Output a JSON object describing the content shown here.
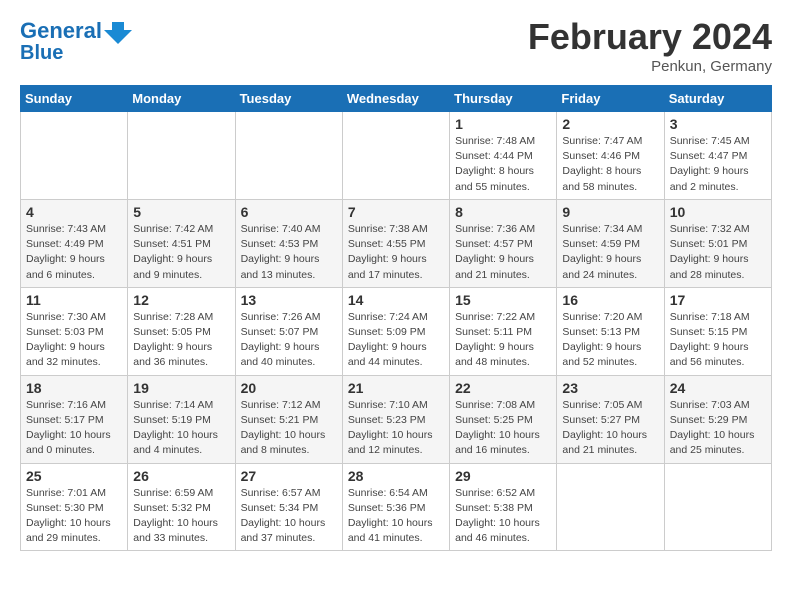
{
  "header": {
    "logo_line1": "General",
    "logo_line2": "Blue",
    "month": "February 2024",
    "location": "Penkun, Germany"
  },
  "weekdays": [
    "Sunday",
    "Monday",
    "Tuesday",
    "Wednesday",
    "Thursday",
    "Friday",
    "Saturday"
  ],
  "weeks": [
    [
      {
        "day": "",
        "info": ""
      },
      {
        "day": "",
        "info": ""
      },
      {
        "day": "",
        "info": ""
      },
      {
        "day": "",
        "info": ""
      },
      {
        "day": "1",
        "info": "Sunrise: 7:48 AM\nSunset: 4:44 PM\nDaylight: 8 hours\nand 55 minutes."
      },
      {
        "day": "2",
        "info": "Sunrise: 7:47 AM\nSunset: 4:46 PM\nDaylight: 8 hours\nand 58 minutes."
      },
      {
        "day": "3",
        "info": "Sunrise: 7:45 AM\nSunset: 4:47 PM\nDaylight: 9 hours\nand 2 minutes."
      }
    ],
    [
      {
        "day": "4",
        "info": "Sunrise: 7:43 AM\nSunset: 4:49 PM\nDaylight: 9 hours\nand 6 minutes."
      },
      {
        "day": "5",
        "info": "Sunrise: 7:42 AM\nSunset: 4:51 PM\nDaylight: 9 hours\nand 9 minutes."
      },
      {
        "day": "6",
        "info": "Sunrise: 7:40 AM\nSunset: 4:53 PM\nDaylight: 9 hours\nand 13 minutes."
      },
      {
        "day": "7",
        "info": "Sunrise: 7:38 AM\nSunset: 4:55 PM\nDaylight: 9 hours\nand 17 minutes."
      },
      {
        "day": "8",
        "info": "Sunrise: 7:36 AM\nSunset: 4:57 PM\nDaylight: 9 hours\nand 21 minutes."
      },
      {
        "day": "9",
        "info": "Sunrise: 7:34 AM\nSunset: 4:59 PM\nDaylight: 9 hours\nand 24 minutes."
      },
      {
        "day": "10",
        "info": "Sunrise: 7:32 AM\nSunset: 5:01 PM\nDaylight: 9 hours\nand 28 minutes."
      }
    ],
    [
      {
        "day": "11",
        "info": "Sunrise: 7:30 AM\nSunset: 5:03 PM\nDaylight: 9 hours\nand 32 minutes."
      },
      {
        "day": "12",
        "info": "Sunrise: 7:28 AM\nSunset: 5:05 PM\nDaylight: 9 hours\nand 36 minutes."
      },
      {
        "day": "13",
        "info": "Sunrise: 7:26 AM\nSunset: 5:07 PM\nDaylight: 9 hours\nand 40 minutes."
      },
      {
        "day": "14",
        "info": "Sunrise: 7:24 AM\nSunset: 5:09 PM\nDaylight: 9 hours\nand 44 minutes."
      },
      {
        "day": "15",
        "info": "Sunrise: 7:22 AM\nSunset: 5:11 PM\nDaylight: 9 hours\nand 48 minutes."
      },
      {
        "day": "16",
        "info": "Sunrise: 7:20 AM\nSunset: 5:13 PM\nDaylight: 9 hours\nand 52 minutes."
      },
      {
        "day": "17",
        "info": "Sunrise: 7:18 AM\nSunset: 5:15 PM\nDaylight: 9 hours\nand 56 minutes."
      }
    ],
    [
      {
        "day": "18",
        "info": "Sunrise: 7:16 AM\nSunset: 5:17 PM\nDaylight: 10 hours\nand 0 minutes."
      },
      {
        "day": "19",
        "info": "Sunrise: 7:14 AM\nSunset: 5:19 PM\nDaylight: 10 hours\nand 4 minutes."
      },
      {
        "day": "20",
        "info": "Sunrise: 7:12 AM\nSunset: 5:21 PM\nDaylight: 10 hours\nand 8 minutes."
      },
      {
        "day": "21",
        "info": "Sunrise: 7:10 AM\nSunset: 5:23 PM\nDaylight: 10 hours\nand 12 minutes."
      },
      {
        "day": "22",
        "info": "Sunrise: 7:08 AM\nSunset: 5:25 PM\nDaylight: 10 hours\nand 16 minutes."
      },
      {
        "day": "23",
        "info": "Sunrise: 7:05 AM\nSunset: 5:27 PM\nDaylight: 10 hours\nand 21 minutes."
      },
      {
        "day": "24",
        "info": "Sunrise: 7:03 AM\nSunset: 5:29 PM\nDaylight: 10 hours\nand 25 minutes."
      }
    ],
    [
      {
        "day": "25",
        "info": "Sunrise: 7:01 AM\nSunset: 5:30 PM\nDaylight: 10 hours\nand 29 minutes."
      },
      {
        "day": "26",
        "info": "Sunrise: 6:59 AM\nSunset: 5:32 PM\nDaylight: 10 hours\nand 33 minutes."
      },
      {
        "day": "27",
        "info": "Sunrise: 6:57 AM\nSunset: 5:34 PM\nDaylight: 10 hours\nand 37 minutes."
      },
      {
        "day": "28",
        "info": "Sunrise: 6:54 AM\nSunset: 5:36 PM\nDaylight: 10 hours\nand 41 minutes."
      },
      {
        "day": "29",
        "info": "Sunrise: 6:52 AM\nSunset: 5:38 PM\nDaylight: 10 hours\nand 46 minutes."
      },
      {
        "day": "",
        "info": ""
      },
      {
        "day": "",
        "info": ""
      }
    ]
  ]
}
